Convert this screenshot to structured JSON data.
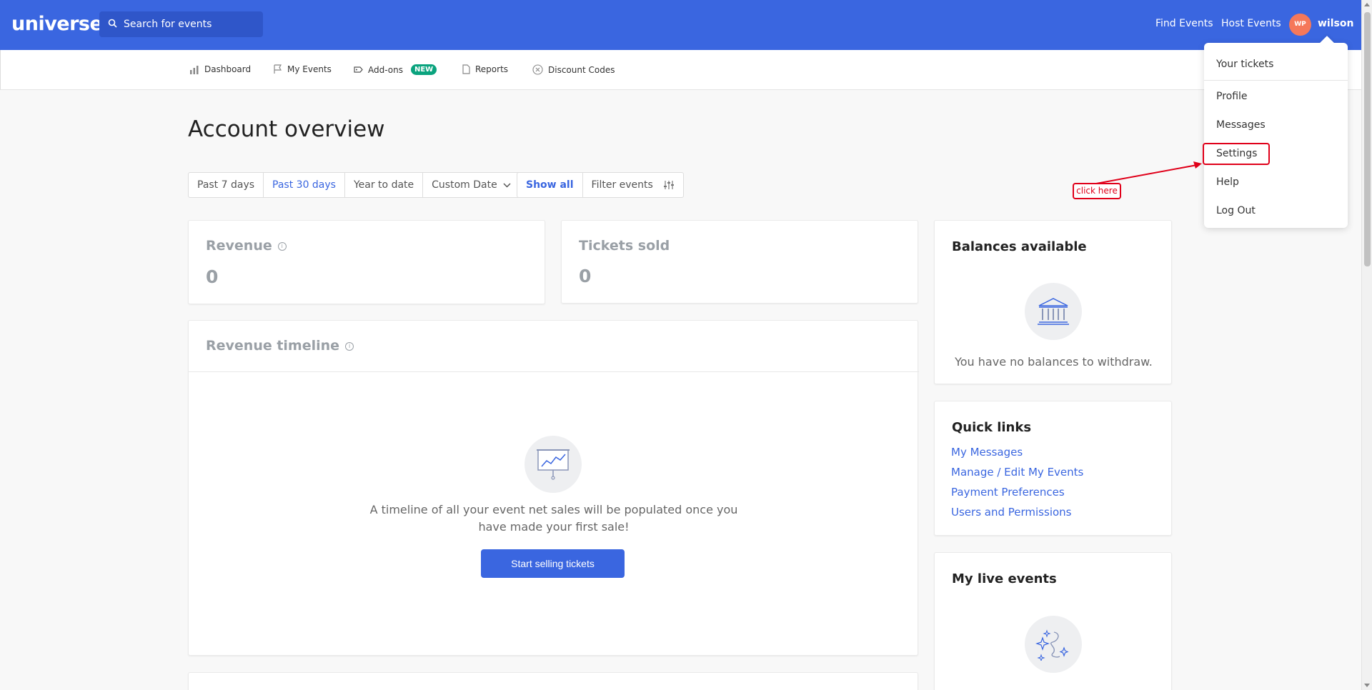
{
  "topbar": {
    "logo": "universe",
    "search_placeholder": "Search for events",
    "find_events": "Find Events",
    "host_events": "Host Events",
    "avatar_initials": "WP",
    "username": "wilson"
  },
  "subnav": {
    "items": [
      {
        "label": "Dashboard",
        "icon": "bar-chart-icon"
      },
      {
        "label": "My Events",
        "icon": "flag-icon"
      },
      {
        "label": "Add-ons",
        "icon": "tag-icon",
        "badge": "NEW"
      },
      {
        "label": "Reports",
        "icon": "document-icon"
      },
      {
        "label": "Discount Codes",
        "icon": "discount-icon"
      }
    ]
  },
  "page": {
    "title": "Account overview"
  },
  "filters": {
    "ranges": [
      "Past 7 days",
      "Past 30 days",
      "Year to date",
      "Custom Date"
    ],
    "active_range": "Past 30 days",
    "show_all": "Show all",
    "filter_events": "Filter events"
  },
  "stats": {
    "revenue_label": "Revenue",
    "revenue_value": "0",
    "tickets_label": "Tickets sold",
    "tickets_value": "0"
  },
  "timeline": {
    "title": "Revenue timeline",
    "empty_text_line1": "A timeline of all your event net sales will be populated once you",
    "empty_text_line2": "have made your first sale!",
    "cta": "Start selling tickets"
  },
  "balances": {
    "title": "Balances available",
    "empty_text": "You have no balances to withdraw."
  },
  "quick_links": {
    "title": "Quick links",
    "links": [
      "My Messages",
      "Manage / Edit My Events",
      "Payment Preferences",
      "Users and Permissions"
    ]
  },
  "live_events": {
    "title": "My live events"
  },
  "user_menu": {
    "items": [
      "Your tickets",
      "Profile",
      "Messages",
      "Settings",
      "Help",
      "Log Out"
    ]
  },
  "annotation": {
    "note": "click here",
    "color": "#e0001a"
  },
  "colors": {
    "brand_blue": "#3a66e0",
    "new_badge": "#0aa37e",
    "avatar": "#f5785a"
  }
}
